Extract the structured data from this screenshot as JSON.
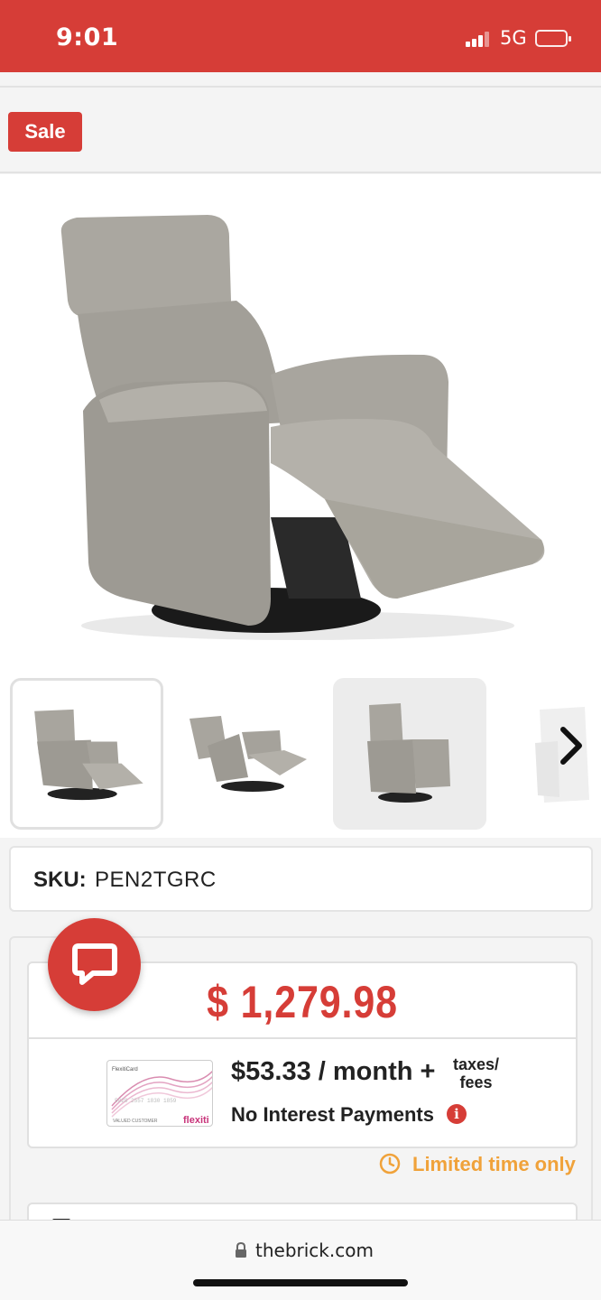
{
  "status_bar": {
    "time": "9:01",
    "network": "5G"
  },
  "sale_badge": "Sale",
  "product_images": {
    "main": "recliner-chair-reclined",
    "thumbnails": [
      "recliner-front-reclined",
      "recliner-side-reclined",
      "recliner-upright",
      "recliner-white-partial"
    ],
    "next_icon": "chevron-right-icon"
  },
  "sku": {
    "label": "SKU:",
    "value": "PEN2TGRC"
  },
  "price": {
    "amount": "$ 1,279.98",
    "financing_card": {
      "brand": "flexiti",
      "card_title": "FlexitiCard",
      "card_number": "5028 2557 1830 1859",
      "holder": "VALUED CUSTOMER"
    },
    "monthly": "$53.33 / month +",
    "taxes_line1": "taxes/",
    "taxes_line2": "fees",
    "no_interest": "No Interest Payments",
    "info_icon": "i",
    "limited_time": "Limited time only"
  },
  "chat_icon": "chat-bubble-icon",
  "browser": {
    "url": "thebrick.com"
  },
  "colors": {
    "brand_red": "#d63d37",
    "accent_orange": "#f0a23a"
  }
}
